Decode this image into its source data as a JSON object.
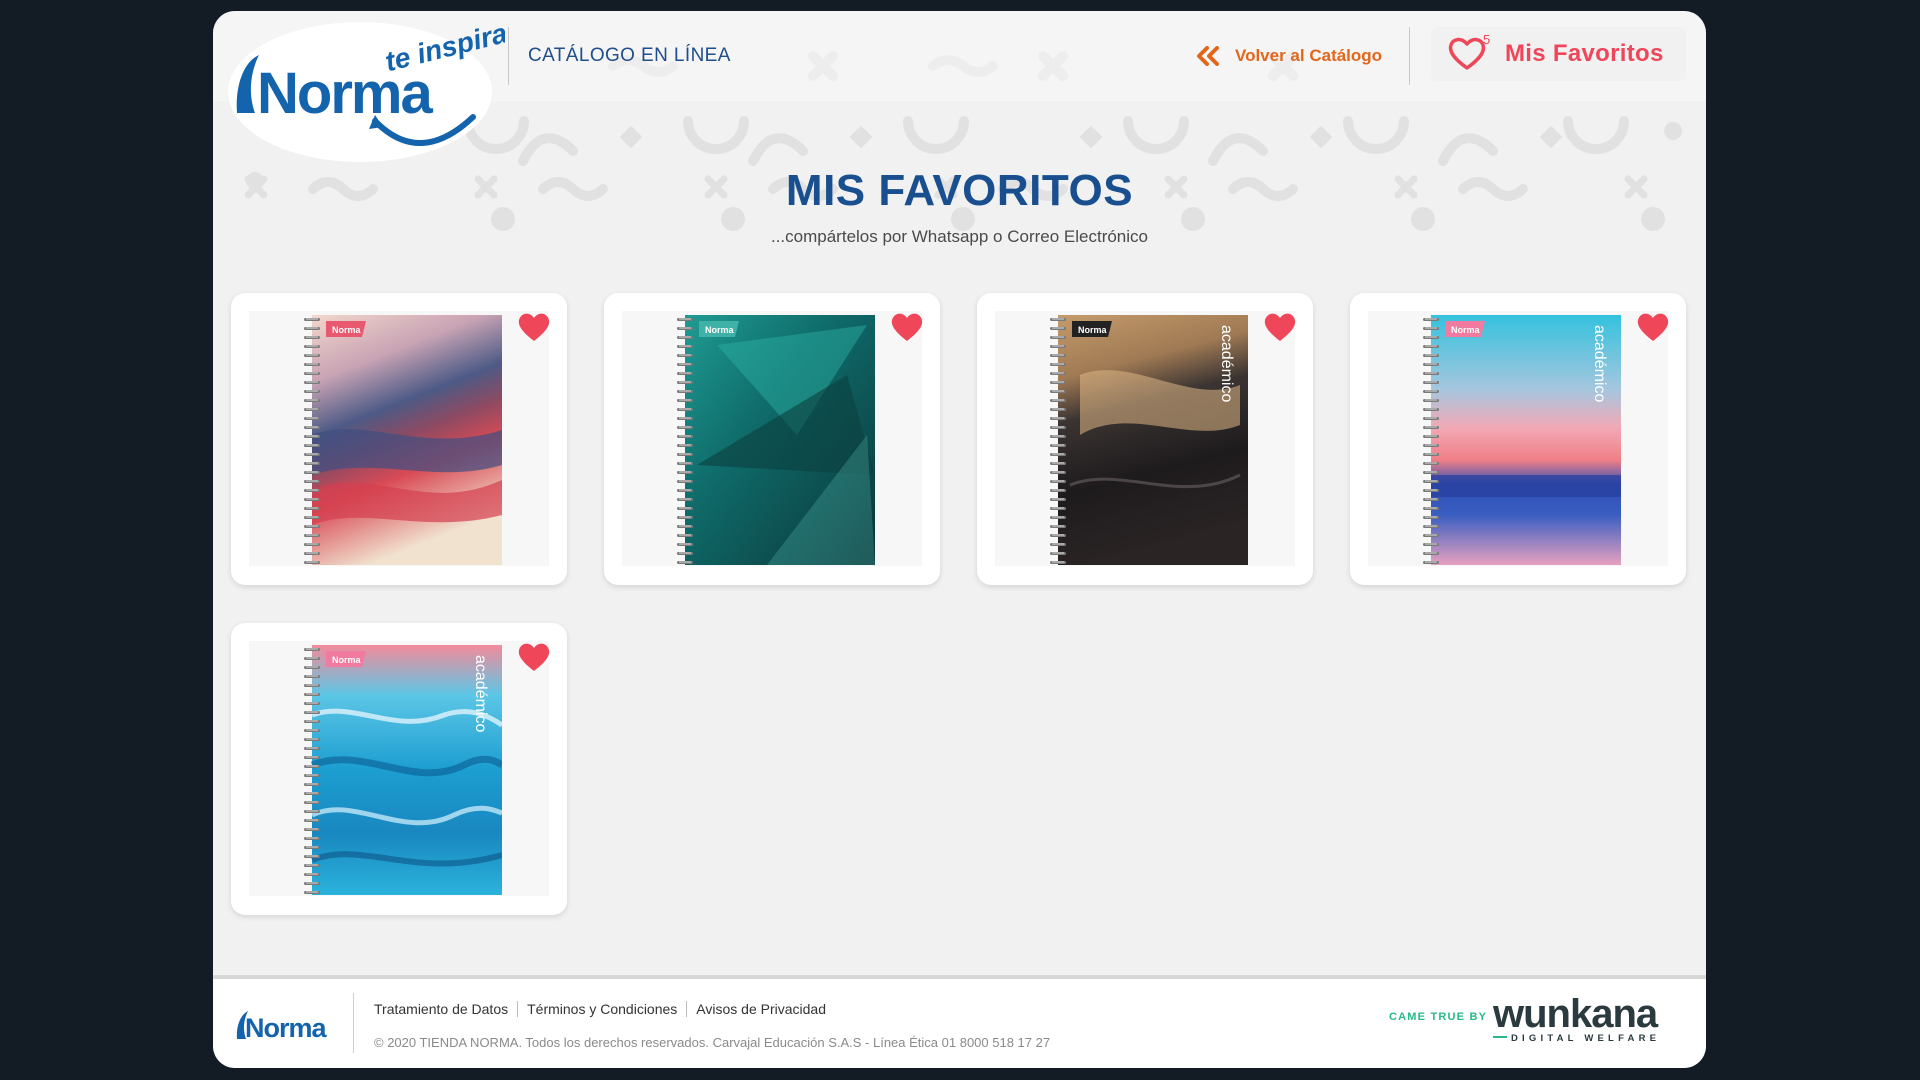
{
  "header": {
    "logo_text": "Norma",
    "logo_tagline": "te inspira",
    "title": "CATÁLOGO EN LÍNEA",
    "back_label": "Volver al Catálogo",
    "favorites_label": "Mis Favoritos",
    "favorites_count": "5"
  },
  "main": {
    "title": "MIS FAVORITOS",
    "subtitle": "...compártelos por Whatsapp o Correo Electrónico",
    "products": [
      {
        "cover": "abstract-brush-pink-blue-red",
        "favorited": true
      },
      {
        "cover": "teal-feathers",
        "favorited": true
      },
      {
        "cover": "marble-black-gold",
        "spine_text": "académico",
        "favorited": true
      },
      {
        "cover": "sunset-sky-sea",
        "spine_text": "académico",
        "favorited": true
      },
      {
        "cover": "blue-water-ripples",
        "spine_text": "académico",
        "favorited": true
      }
    ]
  },
  "footer": {
    "logo_text": "Norma",
    "links": [
      "Tratamiento de Datos",
      "Términos y Condiciones",
      "Avisos de Privacidad"
    ],
    "copyright": "© 2020 TIENDA NORMA. Todos los derechos reservados. Carvajal Educación S.A.S - Línea Ética 01 8000 518 17 27",
    "credit_label": "CAME TRUE BY",
    "credit_brand": "wunkana",
    "credit_sub": "DIGITAL WELFARE"
  },
  "colors": {
    "brand_blue": "#1a4f8f",
    "accent_orange": "#e2671c",
    "heart_red": "#f0465a",
    "credit_green": "#27b98a"
  }
}
